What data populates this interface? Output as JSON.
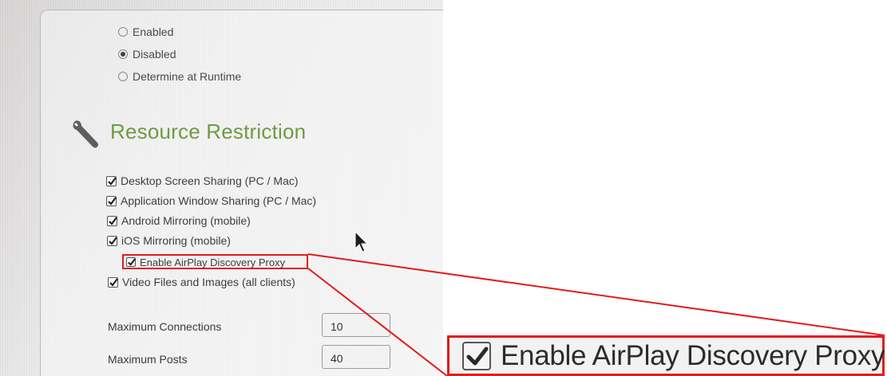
{
  "availability": {
    "options": [
      {
        "label": "Enabled",
        "checked": false
      },
      {
        "label": "Disabled",
        "checked": true
      },
      {
        "label": "Determine at Runtime",
        "checked": false
      }
    ]
  },
  "resource_restriction": {
    "title": "Resource Restriction",
    "icon": "wrench-icon",
    "items": [
      {
        "label": "Desktop Screen Sharing (PC / Mac)",
        "checked": true
      },
      {
        "label": "Application Window Sharing (PC / Mac)",
        "checked": true
      },
      {
        "label": "Android Mirroring (mobile)",
        "checked": true
      },
      {
        "label": "iOS Mirroring (mobile)",
        "checked": true
      },
      {
        "label": "Enable AirPlay Discovery Proxy",
        "checked": true
      },
      {
        "label": "Video Files and Images (all clients)",
        "checked": true
      }
    ]
  },
  "limits": {
    "max_connections": {
      "label": "Maximum Connections",
      "value": "10"
    },
    "max_posts": {
      "label": "Maximum Posts",
      "value": "40"
    }
  },
  "callout": {
    "label": "Enable AirPlay Discovery Proxy",
    "checked": true,
    "highlight_color": "#e21b1b"
  },
  "colors": {
    "section_title": "#6d9b43",
    "highlight": "#e21b1b"
  }
}
